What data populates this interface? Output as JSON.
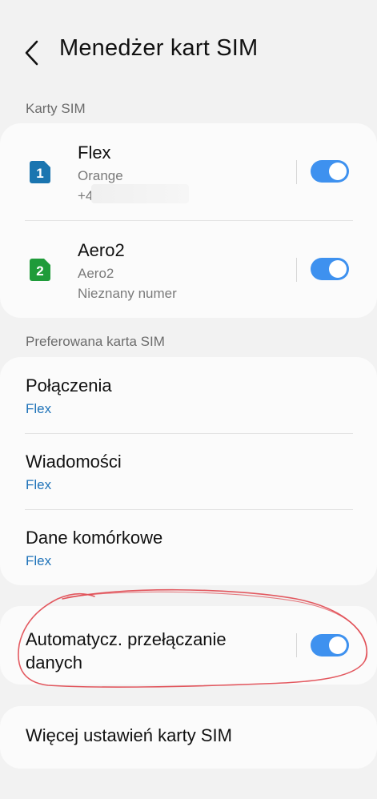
{
  "header": {
    "title": "Menedżer kart SIM",
    "back_icon": "arrow-left-icon"
  },
  "sim_cards": {
    "section_label": "Karty SIM",
    "items": [
      {
        "slot": "1",
        "name": "Flex",
        "operator": "Orange",
        "number": "+4",
        "enabled": true,
        "badge_color": "#1a75b0"
      },
      {
        "slot": "2",
        "name": "Aero2",
        "operator": "Aero2",
        "number": "Nieznany numer",
        "enabled": true,
        "badge_color": "#1f9b3a"
      }
    ]
  },
  "preferred": {
    "section_label": "Preferowana karta SIM",
    "items": [
      {
        "title": "Połączenia",
        "value": "Flex"
      },
      {
        "title": "Wiadomości",
        "value": "Flex"
      },
      {
        "title": "Dane komórkowe",
        "value": "Flex"
      }
    ]
  },
  "auto_switch": {
    "label": "Automatycz. przełączanie danych",
    "enabled": true
  },
  "more": {
    "label": "Więcej ustawień karty SIM"
  },
  "colors": {
    "accent": "#3e91ef",
    "link": "#1f73b9",
    "annotation": "#e0474f"
  }
}
